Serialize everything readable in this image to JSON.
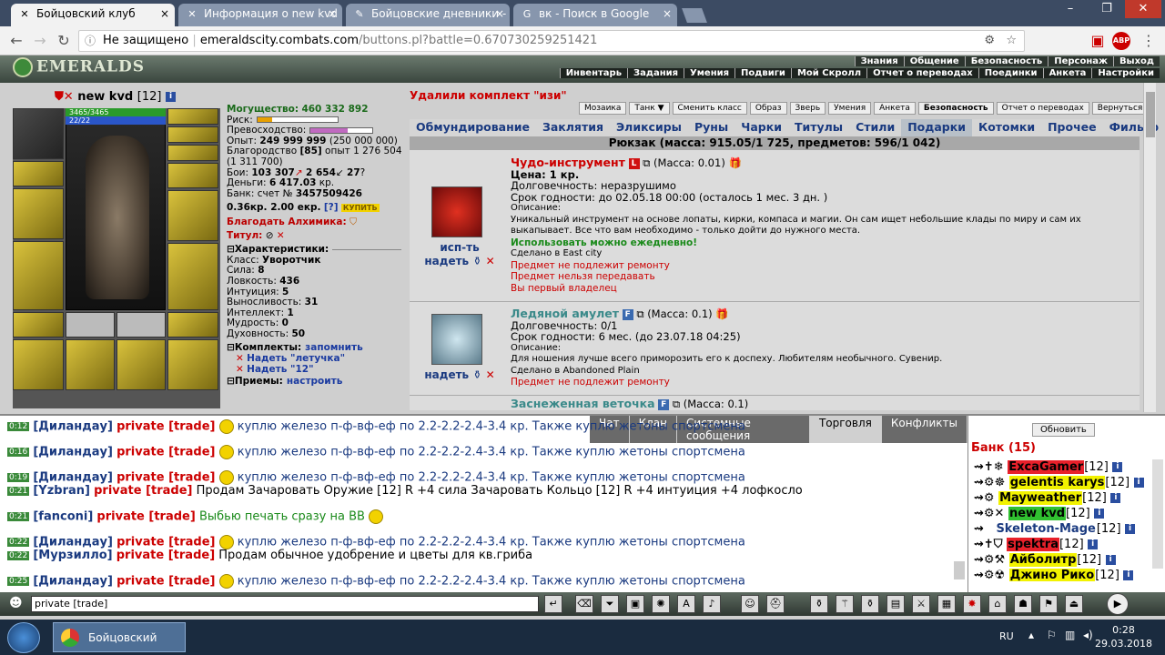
{
  "browser": {
    "tabs": [
      {
        "label": "Бойцовский клуб",
        "active": true
      },
      {
        "label": "Информация о new kvd",
        "active": false
      },
      {
        "label": "Бойцовские дневники - ",
        "active": false
      },
      {
        "label": "вк - Поиск в Google",
        "active": false
      }
    ],
    "security_label": "Не защищено",
    "url_host": "emeraldscity.combats.com",
    "url_path": "/buttons.pl?battle=0.670730259251421"
  },
  "game_header": {
    "logo": "EMERALDS",
    "menu_top": [
      "Знания",
      "Общение",
      "Безопасность",
      "Персонаж",
      "Выход"
    ],
    "menu_bottom": [
      "Инвентарь",
      "Задания",
      "Умения",
      "Подвиги",
      "Мой Скролл",
      "Отчет о переводах",
      "Поединки",
      "Анкета",
      "Настройки"
    ]
  },
  "character": {
    "name": "new kvd",
    "level": "[12]",
    "hp": "3465/3465",
    "mp": "22/22",
    "stats": {
      "might_label": "Могущество:",
      "might": "460 332 892",
      "risk_label": "Риск:",
      "superiority_label": "Превосходство:",
      "exp_label": "Опыт:",
      "exp": "249 999 999",
      "exp_next": "(250 000 000)",
      "nobility_label": "Благородство",
      "nobility": "[85]",
      "nobility_exp": "опыт 1 276 504",
      "nobility_next": "(1 311 700)",
      "fights_label": "Бои:",
      "fights_won": "103 307",
      "fights_lost": "2 654",
      "fights_draw": "27",
      "money_label": "Деньги:",
      "money": "6 417.03",
      "money_unit": "кр.",
      "bank_label": "Банк: счет №",
      "bank": "3457509426",
      "rates": "0.36кр. 2.00 екр.",
      "rates_help": "[?]",
      "buy_label": "КУПИТЬ",
      "alchemist_label": "Благодать Алхимика:",
      "title_label": "Титул:"
    },
    "characteristics": {
      "header": "Характеристики:",
      "class_label": "Класс:",
      "class": "Уворотчик",
      "strength_label": "Сила:",
      "strength": "8",
      "agility_label": "Ловкость:",
      "agility": "436",
      "intuition_label": "Интуиция:",
      "intuition": "5",
      "endurance_label": "Выносливость:",
      "endurance": "31",
      "intellect_label": "Интеллект:",
      "intellect": "1",
      "wisdom_label": "Мудрость:",
      "wisdom": "0",
      "spirituality_label": "Духовность:",
      "spirituality": "50"
    },
    "sets": {
      "header": "Комплекты:",
      "remember": "запомнить",
      "set1": "Надеть \"летучка\"",
      "set2": "Надеть \"12\""
    },
    "techniques": {
      "header": "Приемы:",
      "configure": "настроить"
    }
  },
  "inventory": {
    "message": "Удалили комплект \"изи\"",
    "buttons": [
      "Мозаика",
      "Танк",
      "Сменить класс",
      "Образ",
      "Зверь",
      "Умения",
      "Анкета",
      "Безопасность",
      "Отчет о переводах",
      "Вернуться"
    ],
    "categories": [
      "Обмундирование",
      "Заклятия",
      "Эликсиры",
      "Руны",
      "Чарки",
      "Титулы",
      "Стили",
      "Подарки",
      "Котомки",
      "Прочее",
      "Фильтр"
    ],
    "selected_category": "Подарки",
    "backpack_label": "Рюкзак (масса: 915.05/1 725, предметов: 596/1 042)",
    "items": [
      {
        "action_use": "исп-ть",
        "action_wear": "надеть",
        "title": "Чудо-инструмент",
        "badge": "L",
        "mass": "(Масса: 0.01)",
        "price": "Цена: 1 кр.",
        "durability": "Долговечность: неразрушимо",
        "expiry": "Срок годности: до 02.05.18 00:00 (осталось 1 мес. 3 дн. )",
        "desc_label": "Описание:",
        "desc": "Уникальный инструмент на основе лопаты, кирки, компаса и магии. Он сам ищет небольшие клады по миру и сам их выкапывает. Все что вам необходимо - только дойти до нужного места.",
        "daily": "Использовать можно ежедневно!",
        "made_in": "Сделано в East city",
        "no_repair": "Предмет не подлежит ремонту",
        "no_transfer": "Предмет нельзя передавать",
        "first_owner": "Вы первый владелец"
      },
      {
        "action_wear": "надеть",
        "title": "Ледяной амулет",
        "badge": "F",
        "mass": "(Масса: 0.1)",
        "durability": "Долговечность: 0/1",
        "expiry": "Срок годности: 6 мес. (до 23.07.18 04:25)",
        "desc_label": "Описание:",
        "desc": "Для ношения лучше всего приморозить его к доспеху. Любителям необычного. Сувенир.",
        "made_in": "Сделано в Abandoned Plain",
        "no_repair": "Предмет не подлежит ремонту"
      },
      {
        "title": "Заснеженная веточка",
        "badge": "F",
        "mass": "(Масса: 0.1)"
      }
    ]
  },
  "chat": {
    "tabs": [
      "Чат",
      "Клан",
      "Системные сообщения",
      "Торговля",
      "Конфликты"
    ],
    "selected_tab": "Торговля",
    "lines": [
      {
        "time": "0:12",
        "nick": "[Диландау]",
        "tag": "private [trade]",
        "text": "куплю железо п-ф-вф-еф по 2.2-2.2-2.4-3.4 кр. Также куплю жетоны спортсмена"
      },
      {
        "time": "0:16",
        "nick": "[Диландау]",
        "tag": "private [trade]",
        "text": "куплю железо п-ф-вф-еф по 2.2-2.2-2.4-3.4 кр. Также куплю жетоны спортсмена"
      },
      {
        "time": "0:19",
        "nick": "[Диландау]",
        "tag": "private [trade]",
        "text": "куплю железо п-ф-вф-еф по 2.2-2.2-2.4-3.4 кр. Также куплю жетоны спортсмена"
      },
      {
        "time": "0:21",
        "nick": "[Yzbran]",
        "tag": "private [trade]",
        "text": "Продам Зачаровать Оружие [12] R +4 сила Зачаровать Кольцо [12] R +4 интуиция +4 лофкосло"
      },
      {
        "time": "0:21",
        "nick": "[fanconi]",
        "tag": "private [trade]",
        "text": "Выбью печать сразу на ВВ"
      },
      {
        "time": "0:22",
        "nick": "[Диландау]",
        "tag": "private [trade]",
        "text": "куплю железо п-ф-вф-еф по 2.2-2.2-2.4-3.4 кр. Также куплю жетоны спортсмена"
      },
      {
        "time": "0:22",
        "nick": "[Мурзилло]",
        "tag": "private [trade]",
        "text": "Продам обычное удобрение и цветы для кв.гриба"
      },
      {
        "time": "0:25",
        "nick": "[Диландау]",
        "tag": "private [trade]",
        "text": "куплю железо п-ф-вф-еф по 2.2-2.2-2.4-3.4 кр. Также куплю жетоны спортсмена"
      }
    ],
    "input_value": "private [trade]"
  },
  "room": {
    "refresh_label": "Обновить",
    "title": "Банк (15)",
    "players": [
      {
        "name": "ExcaGamer",
        "level": "[12]",
        "bg": "#e8202a"
      },
      {
        "name": "gelentis karys",
        "level": "[12]",
        "bg": "#f2f200"
      },
      {
        "name": "Mayweather",
        "level": "[12]",
        "bg": "#f2f200"
      },
      {
        "name": "new kvd",
        "level": "[12]",
        "bg": "#30c030"
      },
      {
        "name": "Skeleton-Mage",
        "level": "[12]",
        "bg": ""
      },
      {
        "name": "spektra",
        "level": "[12]",
        "bg": "#e8202a"
      },
      {
        "name": "Айболитр",
        "level": "[12]",
        "bg": "#f2f200"
      },
      {
        "name": "Джино Рико",
        "level": "[12]",
        "bg": "#f2f200"
      }
    ]
  },
  "taskbar": {
    "app_label": "Бойцовский клу...",
    "lang": "RU",
    "time": "0:28",
    "date": "29.03.2018"
  }
}
